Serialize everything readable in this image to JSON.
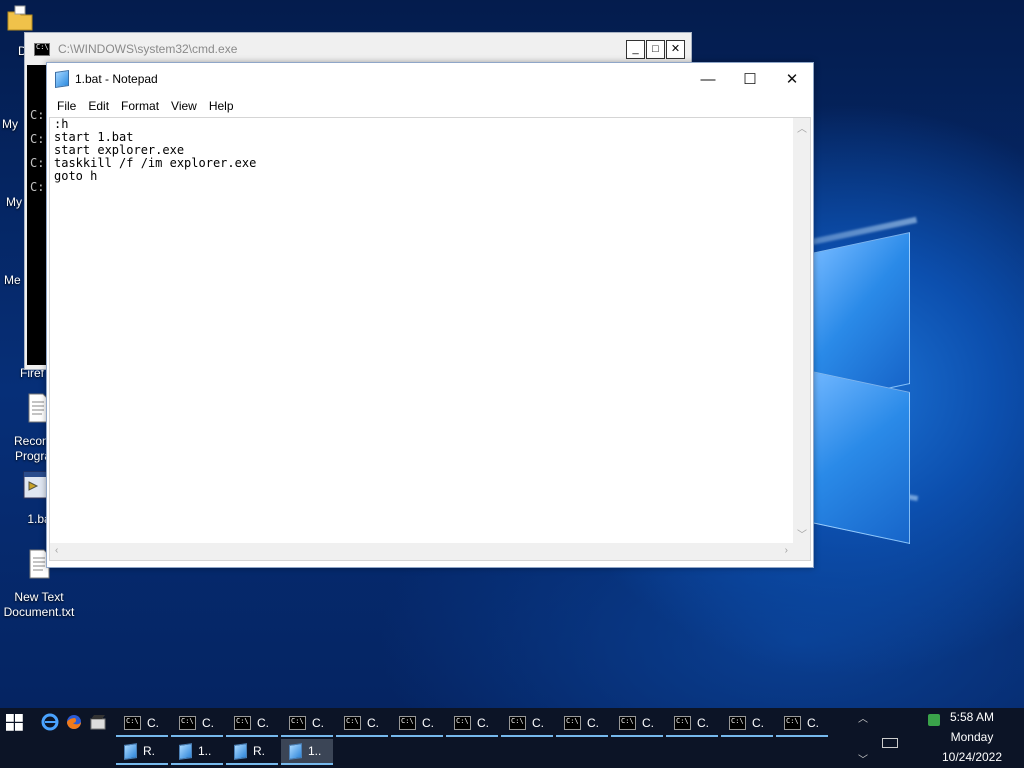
{
  "desktop": {
    "icons": [
      {
        "label": "Do"
      },
      {
        "label": "My"
      },
      {
        "label": "My"
      },
      {
        "label": "Me"
      },
      {
        "label": "Firef"
      },
      {
        "label": "Recomm Program"
      },
      {
        "label": "1.ba"
      },
      {
        "label": "New Text Document.txt"
      }
    ]
  },
  "cmd_window": {
    "title": "C:\\WINDOWS\\system32\\cmd.exe",
    "lines": [
      "C:",
      "C:",
      "C:",
      "C:"
    ],
    "buttons": {
      "minimize": "_",
      "maximize": "□",
      "close": "✕"
    }
  },
  "notepad": {
    "title": "1.bat - Notepad",
    "menu": [
      "File",
      "Edit",
      "Format",
      "View",
      "Help"
    ],
    "content": ":h\nstart 1.bat\nstart explorer.exe\ntaskkill /f /im explorer.exe\ngoto h",
    "controls": {
      "minimize": "—",
      "maximize": "☐",
      "close": "✕"
    }
  },
  "taskbar": {
    "row1_label": "C.",
    "row1_count": 13,
    "row2": [
      {
        "label": "R.",
        "kind": "notepad"
      },
      {
        "label": "1..",
        "kind": "notepad"
      },
      {
        "label": "R.",
        "kind": "notepad"
      },
      {
        "label": "1..",
        "kind": "notepad",
        "active": true
      }
    ],
    "clock": {
      "time": "5:58 AM",
      "day": "Monday",
      "date": "10/24/2022"
    },
    "colors": {
      "accent": "#76b9ed",
      "bar": "#0c1426"
    }
  }
}
